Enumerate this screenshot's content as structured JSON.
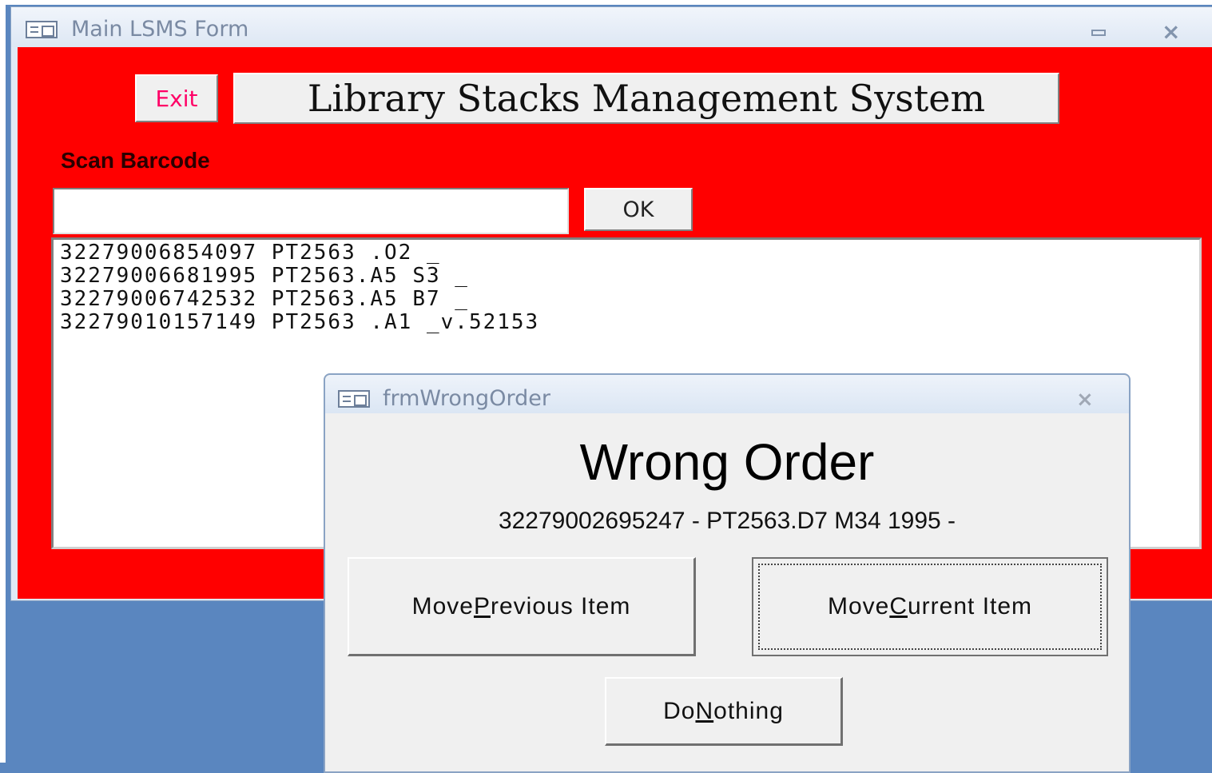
{
  "main_window": {
    "title": "Main LSMS Form",
    "exit_label": "Exit",
    "banner_title": "Library Stacks Management System",
    "scan_label": "Scan Barcode",
    "scan_value": "",
    "ok_label": "OK",
    "scanned_items": [
      "32279006854097 PT2563 .O2 _",
      "32279006681995 PT2563.A5 S3 _",
      "32279006742532 PT2563.A5 B7 _",
      "32279010157149 PT2563 .A1 _v.52153"
    ]
  },
  "dialog": {
    "title": "frmWrongOrder",
    "heading": "Wrong Order",
    "item_text": "32279002695247 - PT2563.D7 M34 1995 -",
    "buttons": {
      "previous": {
        "pre": "Move ",
        "key": "P",
        "post": "revious Item"
      },
      "current": {
        "pre": "Move ",
        "key": "C",
        "post": "urrent Item"
      },
      "nothing": {
        "pre": "Do ",
        "key": "N",
        "post": "othing"
      }
    }
  },
  "colors": {
    "form_background": "#ff0000",
    "desktop": "#5a86bf",
    "exit_text": "#ff0066"
  },
  "icons": [
    "form-icon",
    "minimize-icon",
    "close-icon"
  ]
}
